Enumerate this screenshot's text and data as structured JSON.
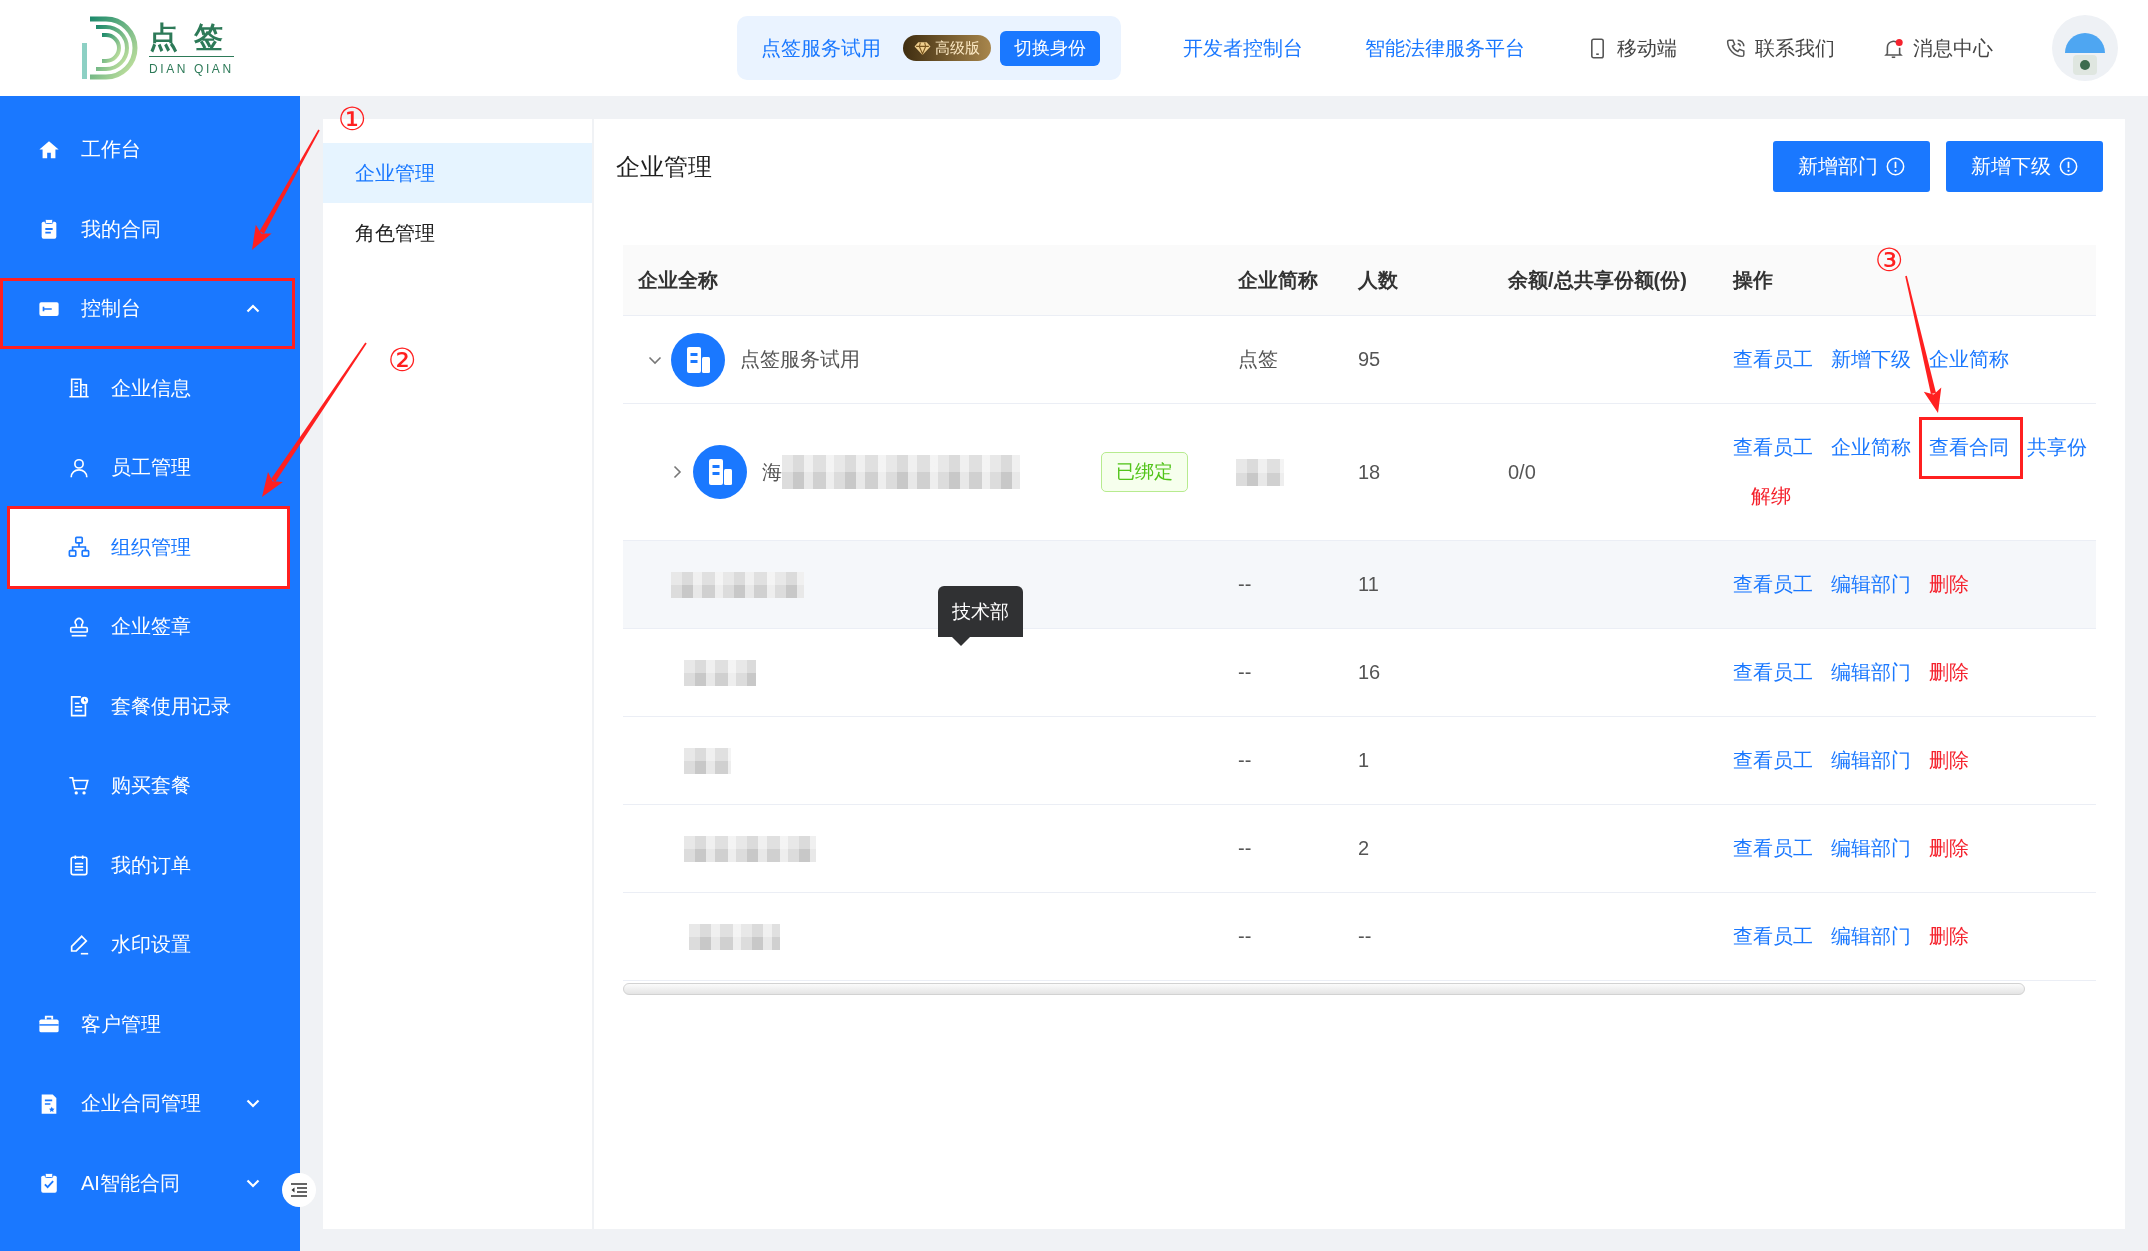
{
  "header": {
    "logo": {
      "name": "点 签",
      "subtitle": "DIAN QIAN"
    },
    "identity": {
      "name": "点签服务试用",
      "badge": "高级版",
      "button": "切换身份"
    },
    "links": [
      {
        "label": "开发者控制台",
        "kind": "link"
      },
      {
        "label": "智能法律服务平台",
        "kind": "link"
      },
      {
        "label": "移动端",
        "kind": "mobile"
      },
      {
        "label": "联系我们",
        "kind": "contact"
      },
      {
        "label": "消息中心",
        "kind": "messages",
        "unread": true
      }
    ]
  },
  "sidebar": {
    "items": [
      {
        "label": "工作台",
        "kind": "item",
        "selected": false
      },
      {
        "label": "我的合同",
        "kind": "item",
        "selected": false
      },
      {
        "label": "控制台",
        "kind": "group",
        "selected": false,
        "expanded": true,
        "callout": "①",
        "children": [
          {
            "label": "企业信息",
            "selected": false
          },
          {
            "label": "员工管理",
            "selected": false
          },
          {
            "label": "组织管理",
            "selected": true,
            "callout": "②"
          },
          {
            "label": "企业签章",
            "selected": false
          },
          {
            "label": "套餐使用记录",
            "selected": false
          },
          {
            "label": "购买套餐",
            "selected": false
          },
          {
            "label": "我的订单",
            "selected": false
          },
          {
            "label": "水印设置",
            "selected": false
          }
        ]
      },
      {
        "label": "客户管理",
        "kind": "item",
        "selected": false
      },
      {
        "label": "企业合同管理",
        "kind": "group",
        "selected": false,
        "expanded": false
      },
      {
        "label": "AI智能合同",
        "kind": "group",
        "selected": false,
        "expanded": false
      }
    ]
  },
  "subnav": {
    "items": [
      {
        "label": "企业管理",
        "selected": true
      },
      {
        "label": "角色管理",
        "selected": false
      }
    ]
  },
  "page": {
    "title": "企业管理",
    "buttons": [
      {
        "label": "新增部门"
      },
      {
        "label": "新增下级"
      }
    ]
  },
  "table": {
    "columns": [
      "企业全称",
      "企业简称",
      "人数",
      "余额/总共享份额(份)",
      "操作"
    ],
    "rows": [
      {
        "kind": "company",
        "expanded": true,
        "highlighted": false,
        "name": "点签服务试用",
        "short_name": "点签",
        "count": "95",
        "actions": [
          {
            "label": "查看员工",
            "kind": "link"
          },
          {
            "label": "新增下级",
            "kind": "link"
          },
          {
            "label": "企业简称",
            "kind": "link"
          }
        ],
        "children": [
          {
            "kind": "company",
            "expanded": false,
            "highlighted": false,
            "name": "海",
            "name_redacted": true,
            "tag": "已绑定",
            "short_name_redacted": true,
            "count": "18",
            "quota": "0/0",
            "actions": [
              {
                "label": "查看员工",
                "kind": "link"
              },
              {
                "label": "企业简称",
                "kind": "link"
              },
              {
                "label": "查看合同",
                "kind": "link",
                "callout": "③"
              },
              {
                "label": "共享份",
                "kind": "link"
              },
              {
                "label": "解绑",
                "kind": "danger"
              }
            ]
          },
          {
            "kind": "department",
            "highlighted": true,
            "name_redacted": true,
            "tooltip": "技术部",
            "short_name": "--",
            "count": "11",
            "actions": [
              {
                "label": "查看员工",
                "kind": "link"
              },
              {
                "label": "编辑部门",
                "kind": "link"
              },
              {
                "label": "删除",
                "kind": "danger"
              }
            ]
          },
          {
            "kind": "department",
            "highlighted": false,
            "name_redacted": true,
            "short_name": "--",
            "count": "16",
            "actions": [
              {
                "label": "查看员工",
                "kind": "link"
              },
              {
                "label": "编辑部门",
                "kind": "link"
              },
              {
                "label": "删除",
                "kind": "danger"
              }
            ]
          },
          {
            "kind": "department",
            "highlighted": false,
            "name_redacted": true,
            "short_name": "--",
            "count": "1",
            "actions": [
              {
                "label": "查看员工",
                "kind": "link"
              },
              {
                "label": "编辑部门",
                "kind": "link"
              },
              {
                "label": "删除",
                "kind": "danger"
              }
            ]
          },
          {
            "kind": "department",
            "highlighted": false,
            "name_redacted": true,
            "short_name": "--",
            "count": "2",
            "actions": [
              {
                "label": "查看员工",
                "kind": "link"
              },
              {
                "label": "编辑部门",
                "kind": "link"
              },
              {
                "label": "删除",
                "kind": "danger"
              }
            ]
          },
          {
            "kind": "department",
            "highlighted": false,
            "name_redacted": true,
            "short_name": "--",
            "count": "--",
            "actions": [
              {
                "label": "查看员工",
                "kind": "link"
              },
              {
                "label": "编辑部门",
                "kind": "link"
              },
              {
                "label": "删除",
                "kind": "danger"
              }
            ]
          }
        ]
      }
    ]
  }
}
